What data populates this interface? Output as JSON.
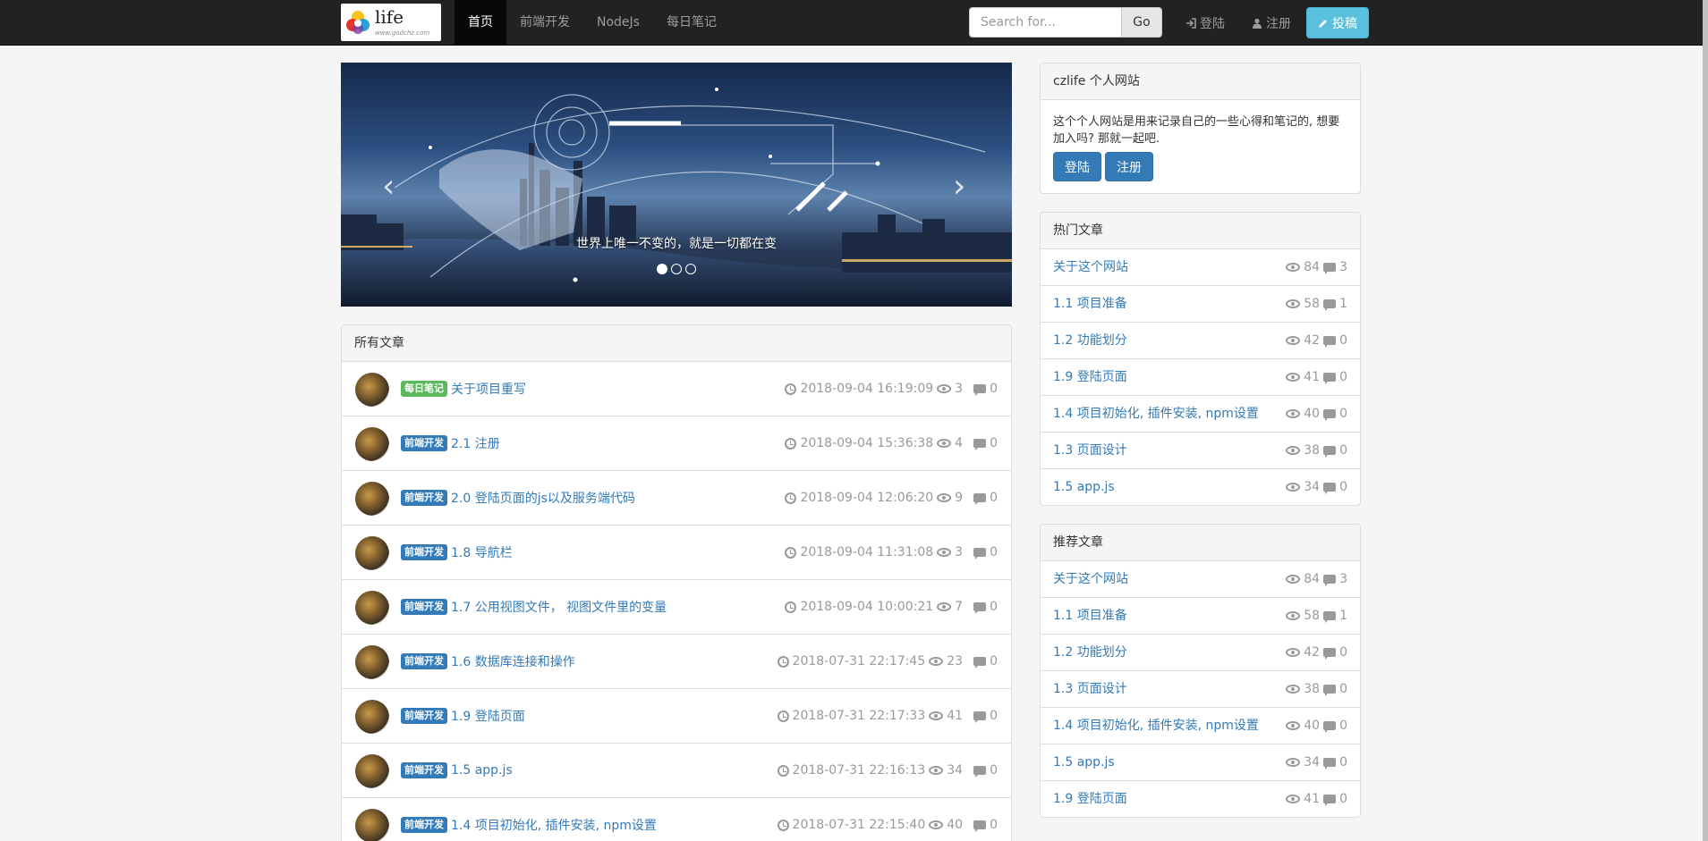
{
  "brand": {
    "logo_text": "life",
    "logo_url": "www.godchz.com"
  },
  "nav": {
    "items": [
      {
        "label": "首页",
        "active": true
      },
      {
        "label": "前端开发",
        "active": false
      },
      {
        "label": "NodeJs",
        "active": false
      },
      {
        "label": "每日笔记",
        "active": false
      }
    ]
  },
  "search": {
    "placeholder": "Search for...",
    "button_label": "Go"
  },
  "nav_right": {
    "login_label": "登陆",
    "register_label": "注册",
    "post_label": "投稿"
  },
  "carousel": {
    "caption": "世界上唯一不变的，就是一切都在变",
    "slide_count": 3,
    "active_index": 0
  },
  "articles_panel": {
    "heading": "所有文章",
    "items": [
      {
        "tag": "每日笔记",
        "tag_color": "#5cb85c",
        "title": "关于项目重写",
        "date": "2018-09-04 16:19:09",
        "views": "3",
        "comments": "0"
      },
      {
        "tag": "前端开发",
        "tag_color": "#337ab7",
        "title": "2.1 注册",
        "date": "2018-09-04 15:36:38",
        "views": "4",
        "comments": "0"
      },
      {
        "tag": "前端开发",
        "tag_color": "#337ab7",
        "title": "2.0 登陆页面的js以及服务端代码",
        "date": "2018-09-04 12:06:20",
        "views": "9",
        "comments": "0"
      },
      {
        "tag": "前端开发",
        "tag_color": "#337ab7",
        "title": "1.8 导航栏",
        "date": "2018-09-04 11:31:08",
        "views": "3",
        "comments": "0"
      },
      {
        "tag": "前端开发",
        "tag_color": "#337ab7",
        "title": "1.7 公用视图文件， 视图文件里的变量",
        "date": "2018-09-04 10:00:21",
        "views": "7",
        "comments": "0"
      },
      {
        "tag": "前端开发",
        "tag_color": "#337ab7",
        "title": "1.6 数据库连接和操作",
        "date": "2018-07-31 22:17:45",
        "views": "23",
        "comments": "0"
      },
      {
        "tag": "前端开发",
        "tag_color": "#337ab7",
        "title": "1.9 登陆页面",
        "date": "2018-07-31 22:17:33",
        "views": "41",
        "comments": "0"
      },
      {
        "tag": "前端开发",
        "tag_color": "#337ab7",
        "title": "1.5 app.js",
        "date": "2018-07-31 22:16:13",
        "views": "34",
        "comments": "0"
      },
      {
        "tag": "前端开发",
        "tag_color": "#337ab7",
        "title": "1.4 项目初始化, 插件安装, npm设置",
        "date": "2018-07-31 22:15:40",
        "views": "40",
        "comments": "0"
      }
    ]
  },
  "intro_panel": {
    "heading": "czlife 个人网站",
    "text": "这个个人网站是用来记录自己的一些心得和笔记的, 想要加入吗? 那就一起吧.",
    "login_label": "登陆",
    "register_label": "注册"
  },
  "hot_panel": {
    "heading": "热门文章",
    "items": [
      {
        "title": "关于这个网站",
        "views": "84",
        "comments": "3"
      },
      {
        "title": "1.1 项目准备",
        "views": "58",
        "comments": "1"
      },
      {
        "title": "1.2 功能划分",
        "views": "42",
        "comments": "0"
      },
      {
        "title": "1.9 登陆页面",
        "views": "41",
        "comments": "0"
      },
      {
        "title": "1.4 项目初始化, 插件安装, npm设置",
        "views": "40",
        "comments": "0"
      },
      {
        "title": "1.3 页面设计",
        "views": "38",
        "comments": "0"
      },
      {
        "title": "1.5 app.js",
        "views": "34",
        "comments": "0"
      }
    ]
  },
  "rec_panel": {
    "heading": "推荐文章",
    "items": [
      {
        "title": "关于这个网站",
        "views": "84",
        "comments": "3"
      },
      {
        "title": "1.1 项目准备",
        "views": "58",
        "comments": "1"
      },
      {
        "title": "1.2 功能划分",
        "views": "42",
        "comments": "0"
      },
      {
        "title": "1.3 页面设计",
        "views": "38",
        "comments": "0"
      },
      {
        "title": "1.4 项目初始化, 插件安装, npm设置",
        "views": "40",
        "comments": "0"
      },
      {
        "title": "1.5 app.js",
        "views": "34",
        "comments": "0"
      },
      {
        "title": "1.9 登陆页面",
        "views": "41",
        "comments": "0"
      }
    ]
  },
  "colors": {
    "navbar": "#222222",
    "link": "#337ab7",
    "info": "#5bc0de",
    "success": "#5cb85c"
  }
}
